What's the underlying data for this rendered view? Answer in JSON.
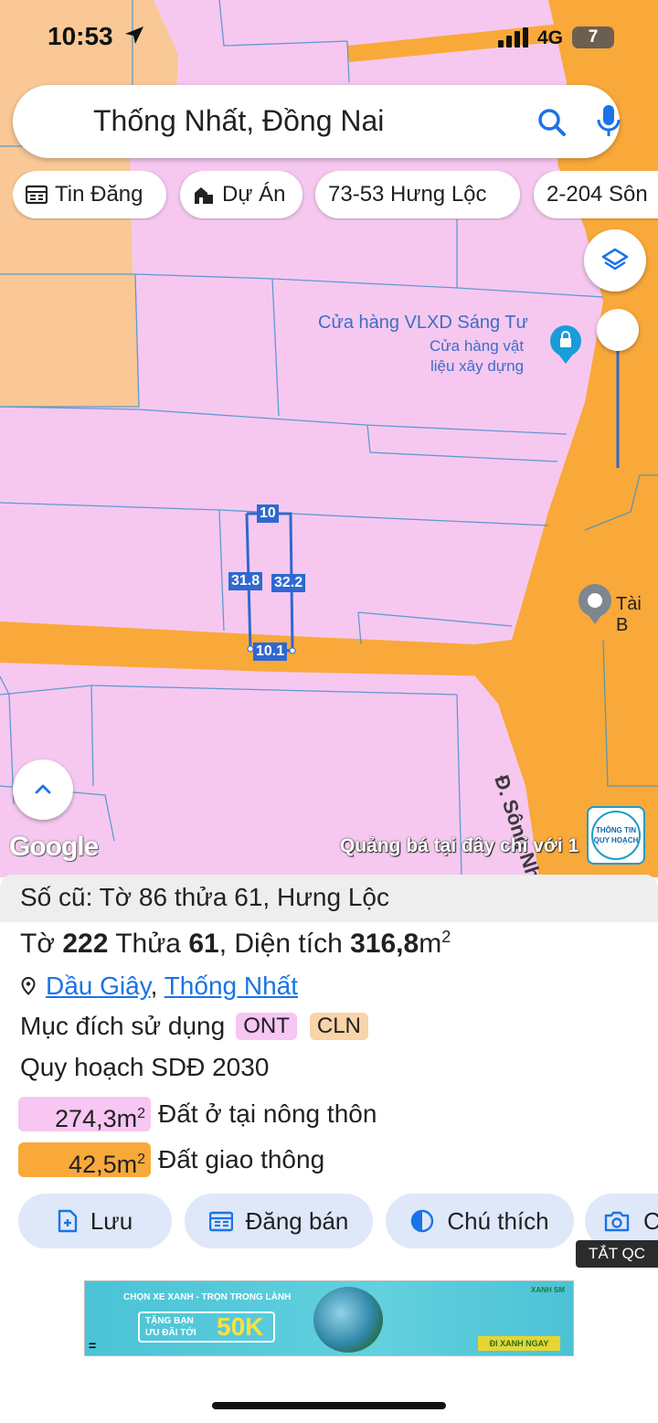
{
  "status_bar": {
    "time": "10:53",
    "network": "4G",
    "battery": "7"
  },
  "search": {
    "query": "Thống Nhất, Đồng Nai"
  },
  "chips": [
    {
      "label": "Tin Đăng",
      "icon": "news-icon"
    },
    {
      "label": "Dự Án",
      "icon": "building-icon"
    },
    {
      "label": "73-53 Hưng Lộc",
      "icon": ""
    },
    {
      "label": "2-204 Sôn",
      "icon": ""
    }
  ],
  "map": {
    "poi": {
      "name": "Cửa hàng VLXD Sáng Tư",
      "category_line1": "Cửa hàng vật",
      "category_line2": "liệu xây dựng"
    },
    "poi_right": "Tài B",
    "road_label": "Đ. Sông Nhạn",
    "dimensions": {
      "top": "10",
      "left": "31.8",
      "right": "32.2",
      "bottom": "10.1"
    },
    "google_label": "Google",
    "ad_ticker": "Quảng bá tại đây chỉ với 1",
    "planning_badge_line1": "THÔNG TIN",
    "planning_badge_line2": "QUY HOẠCH"
  },
  "sheet": {
    "old_parcel": "Số cũ: Tờ 86 thửa 61, Hưng Lộc",
    "parcel": {
      "sheet_label": "Tờ",
      "sheet_no": "222",
      "plot_label": "Thửa",
      "plot_no": "61",
      "area_label": ", Diện tích",
      "area_value": "316,8",
      "area_unit": "m",
      "area_sup": "2"
    },
    "location": {
      "district": "Dầu Giây",
      "separator": ", ",
      "city": "Thống Nhất"
    },
    "purpose_label": "Mục đích sử dụng",
    "purpose_tags": [
      "ONT",
      "CLN"
    ],
    "plan_title": "Quy hoạch SDĐ 2030",
    "plan_rows": [
      {
        "area": "274,3m",
        "sup": "2",
        "label": "Đất ở tại nông thôn",
        "color": "#f7c6f2"
      },
      {
        "area": "42,5m",
        "sup": "2",
        "label": "Đất giao thông",
        "color": "#f9a93a"
      }
    ],
    "actions": [
      {
        "label": "Lưu",
        "icon": "add-file-icon"
      },
      {
        "label": "Đăng bán",
        "icon": "calendar-icon"
      },
      {
        "label": "Chú thích",
        "icon": "contrast-icon"
      },
      {
        "label": "C",
        "icon": "camera-icon"
      }
    ]
  },
  "ad": {
    "close_label": "TẮT QC",
    "line1": "CHỌN XE XANH - TRỌN TRONG LÀNH",
    "line2a": "TẶNG BẠN",
    "line2b": "ƯU ĐÃI TỚI",
    "amount": "50K",
    "cta": "ĐI XANH NGAY",
    "brand": "XANH SM",
    "menu_glyph": "="
  },
  "colors": {
    "residential": "#f6c8f0",
    "road": "#f9a93a",
    "agri": "#f9c896",
    "accent": "#1a73e8",
    "parcel_line": "#2f68d0"
  }
}
